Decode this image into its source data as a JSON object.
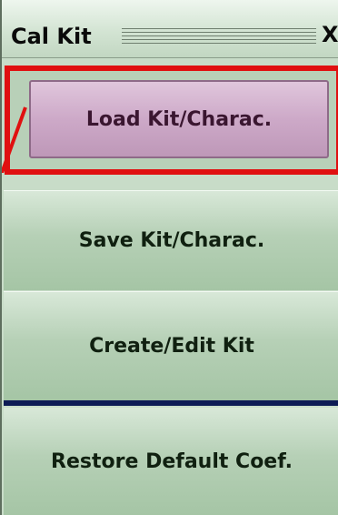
{
  "panel": {
    "title": "Cal Kit",
    "close_label": "X"
  },
  "buttons": {
    "load": "Load Kit/Charac.",
    "save": "Save Kit/Charac.",
    "create": "Create/Edit Kit",
    "restore": "Restore Default Coef."
  },
  "colors": {
    "highlight": "#e01010",
    "panel": "#c8dcc8",
    "selected_button": "#cda9c8",
    "separator": "#0d1b55"
  }
}
